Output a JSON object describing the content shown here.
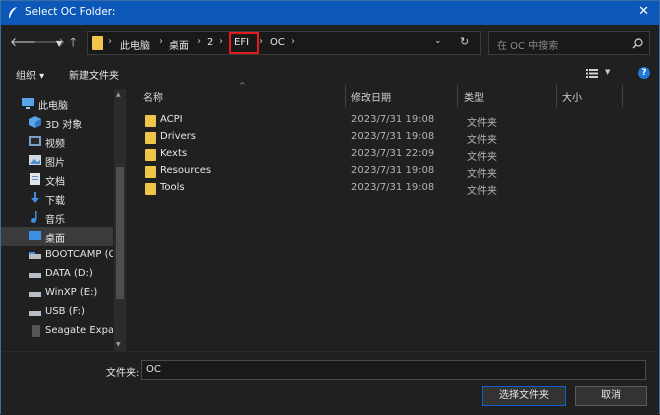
{
  "window": {
    "title": "Select OC Folder:"
  },
  "nav": {
    "breadcrumbs": [
      "此电脑",
      "桌面",
      "2",
      "EFI",
      "OC"
    ],
    "search_placeholder": "在 OC 中搜索"
  },
  "toolbar": {
    "organize_label": "组织 ▾",
    "new_folder_label": "新建文件夹"
  },
  "sidebar": {
    "items": [
      {
        "label": "此电脑",
        "icon": "computer-icon"
      },
      {
        "label": "3D 对象",
        "icon": "cube-icon"
      },
      {
        "label": "视频",
        "icon": "video-icon"
      },
      {
        "label": "图片",
        "icon": "image-icon"
      },
      {
        "label": "文档",
        "icon": "document-icon"
      },
      {
        "label": "下载",
        "icon": "download-icon"
      },
      {
        "label": "音乐",
        "icon": "music-icon"
      },
      {
        "label": "桌面",
        "icon": "desktop-icon",
        "selected": true
      },
      {
        "label": "BOOTCAMP (C",
        "icon": "drive-icon"
      },
      {
        "label": "DATA (D:)",
        "icon": "drive-icon"
      },
      {
        "label": "WinXP  (E:)",
        "icon": "drive-icon"
      },
      {
        "label": "USB (F:)",
        "icon": "usb-drive-icon"
      },
      {
        "label": "Seagate Expan",
        "icon": "external-drive-icon"
      }
    ]
  },
  "filelist": {
    "columns": [
      "名称",
      "修改日期",
      "类型",
      "大小"
    ],
    "rows": [
      {
        "name": "ACPI",
        "modified": "2023/7/31 19:08",
        "type": "文件夹"
      },
      {
        "name": "Drivers",
        "modified": "2023/7/31 19:08",
        "type": "文件夹"
      },
      {
        "name": "Kexts",
        "modified": "2023/7/31 22:09",
        "type": "文件夹"
      },
      {
        "name": "Resources",
        "modified": "2023/7/31 19:08",
        "type": "文件夹"
      },
      {
        "name": "Tools",
        "modified": "2023/7/31 19:08",
        "type": "文件夹"
      }
    ]
  },
  "footer": {
    "folder_label": "文件夹:",
    "folder_value": "OC",
    "select_button": "选择文件夹",
    "cancel_button": "取消"
  },
  "colors": {
    "titlebar": "#0b58b8",
    "background": "#202020",
    "highlight": "#e21c1c",
    "folder": "#f0c64a"
  }
}
